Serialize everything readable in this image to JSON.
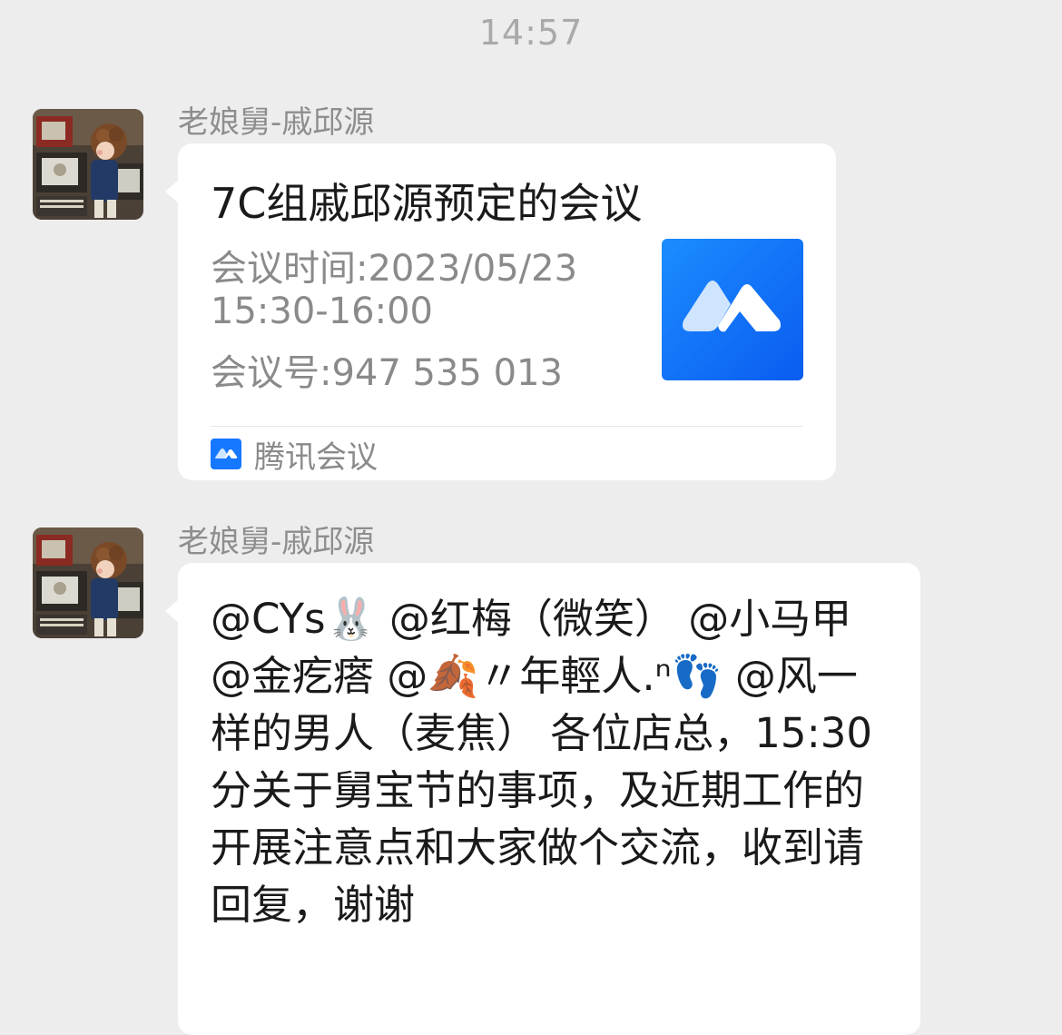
{
  "timestamp": "14:57",
  "messages": [
    {
      "sender": "老娘舅-戚邱源",
      "avatar": "retro-tv-boy-avatar",
      "card": {
        "title": "7C组戚邱源预定的会议",
        "lines": [
          "会议时间:2023/05/23",
          "15:30-16:00",
          "会议号:947 535 013"
        ],
        "logo": "tencent-meeting-logo",
        "source_label": "腾讯会议",
        "brand_color": "#1677ff"
      }
    },
    {
      "sender": "老娘舅-戚邱源",
      "avatar": "retro-tv-boy-avatar",
      "text": "@CYs🐰 @红梅（微笑） @小马甲 @金疙瘩 @🍂〃年輕人.ⁿ👣 @风一样的男人（麦焦） 各位店总，15:30分关于舅宝节的事项，及近期工作的开展注意点和大家做个交流，收到请回复，谢谢"
    }
  ],
  "colors": {
    "background": "#ededed",
    "bubble": "#ffffff",
    "meta_text": "#8e8e8e"
  }
}
